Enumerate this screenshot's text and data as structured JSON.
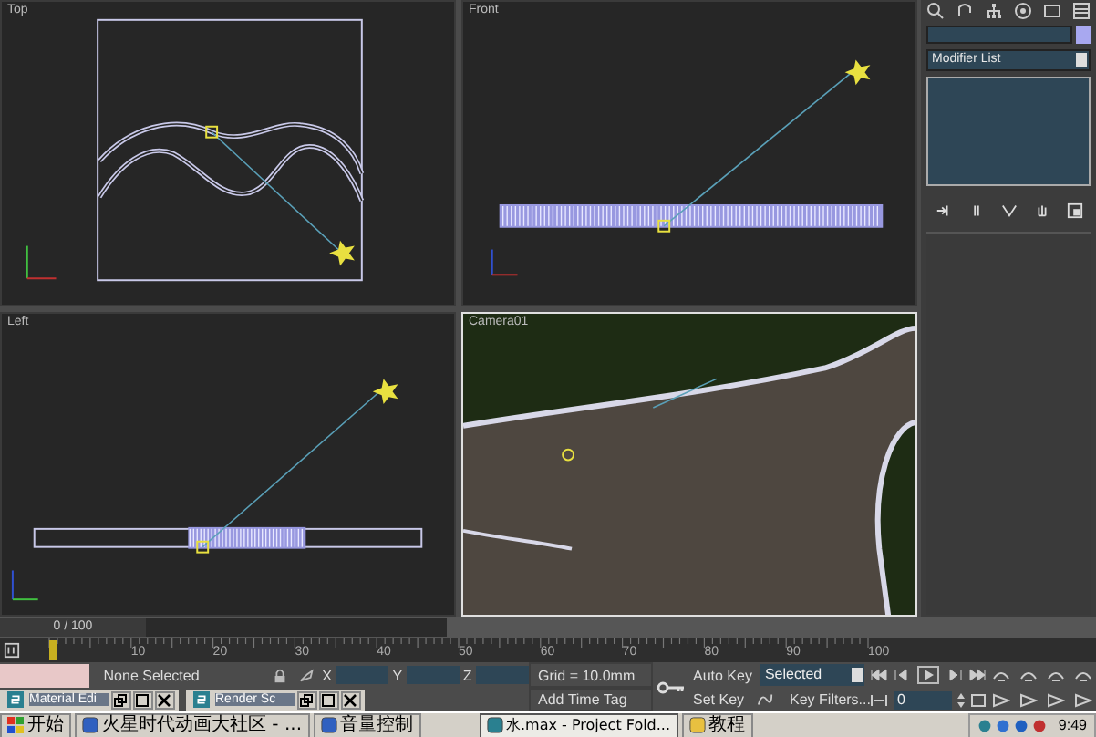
{
  "viewports": [
    {
      "label": "Top",
      "kind": "top",
      "selected": false
    },
    {
      "label": "Front",
      "kind": "front",
      "selected": false
    },
    {
      "label": "Left",
      "kind": "left",
      "selected": false
    },
    {
      "label": "Camera01",
      "kind": "camera",
      "selected": true
    }
  ],
  "command_panel": {
    "modifier_list": "Modifier List"
  },
  "time_slider": {
    "label": "0 / 100",
    "level": 0
  },
  "ruler_labels": [
    "10",
    "20",
    "30",
    "40",
    "50",
    "60",
    "70",
    "80",
    "90",
    "100"
  ],
  "status": {
    "selection": "None Selected",
    "x_label": "X",
    "y_label": "Y",
    "z_label": "Z",
    "grid": "Grid = 10.0mm",
    "time_tag": "Add Time Tag",
    "auto_key": "Auto Key",
    "key_mode": "Selected",
    "set_key": "Set Key",
    "key_filters": "Key Filters...",
    "frame": "0"
  },
  "minimized_windows": [
    {
      "title": "Material Edi"
    },
    {
      "title": "Render Sc"
    }
  ],
  "taskbar": {
    "start": "开始",
    "items": [
      {
        "title": "火星时代动画大社区 - ...",
        "selected": false
      },
      {
        "title": "音量控制",
        "selected": false
      },
      {
        "title": "水.max  - Project Fold...",
        "selected": true
      },
      {
        "title": "教程",
        "selected": false
      }
    ],
    "clock": "9:49"
  }
}
